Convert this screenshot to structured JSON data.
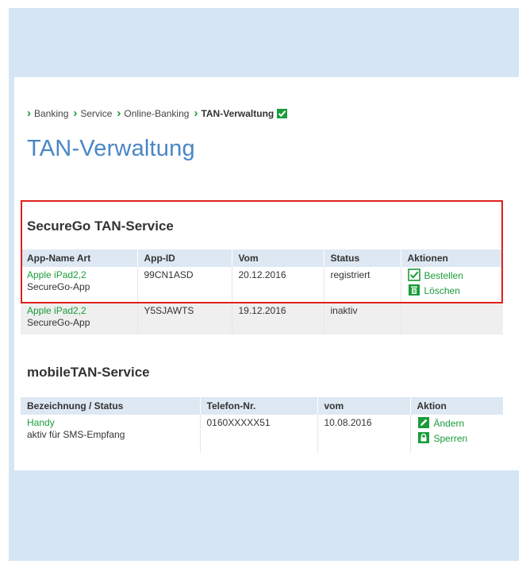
{
  "breadcrumb": {
    "items": [
      "Banking",
      "Service",
      "Online-Banking"
    ],
    "current": "TAN-Verwaltung"
  },
  "page_title": "TAN-Verwaltung",
  "securego": {
    "title": "SecureGo TAN-Service",
    "headers": [
      "App-Name Art",
      "App-ID",
      "Vom",
      "Status",
      "Aktionen"
    ],
    "rows": [
      {
        "name": "Apple iPad2,2",
        "type": "SecureGo-App",
        "app_id": "99CN1ASD",
        "vom": "20.12.2016",
        "status": "registriert",
        "actions": [
          {
            "label": "Bestellen",
            "icon": "checkbox-icon"
          },
          {
            "label": "Löschen",
            "icon": "trash-icon"
          }
        ]
      },
      {
        "name": "Apple iPad2,2",
        "type": "SecureGo-App",
        "app_id": "Y5SJAWTS",
        "vom": "19.12.2016",
        "status": "inaktiv",
        "actions": []
      }
    ]
  },
  "mobiletan": {
    "title": "mobileTAN-Service",
    "headers": [
      "Bezeichnung / Status",
      "Telefon-Nr.",
      "vom",
      "Aktion"
    ],
    "rows": [
      {
        "name": "Handy",
        "status": "aktiv für SMS-Empfang",
        "phone": "0160XXXXX51",
        "vom": "10.08.2016",
        "actions": [
          {
            "label": "Ändern",
            "icon": "pencil-icon"
          },
          {
            "label": "Sperren",
            "icon": "lock-icon"
          }
        ]
      }
    ]
  },
  "colors": {
    "accent_green": "#1a9c3a",
    "title_blue": "#4a86c5",
    "frame_blue": "#d6e5f4",
    "header_blue": "#dde8f3",
    "highlight_red": "#e0201c"
  }
}
